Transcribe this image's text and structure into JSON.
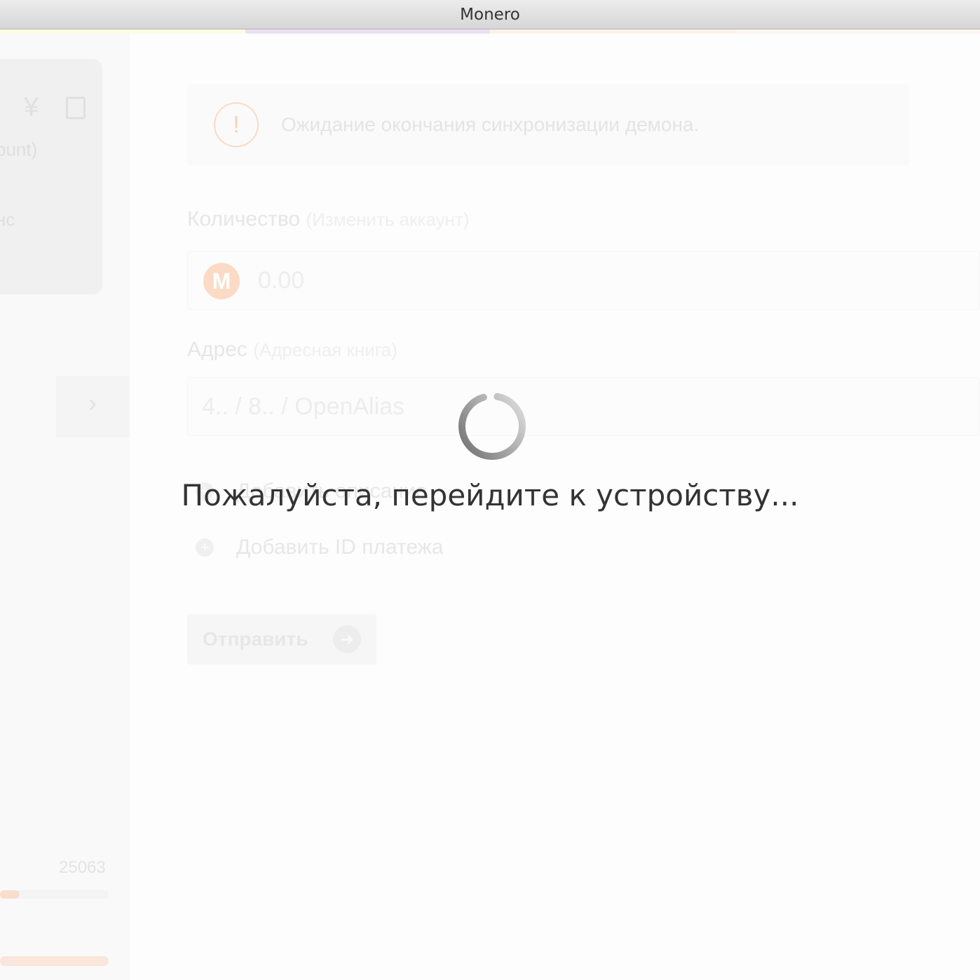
{
  "window": {
    "title": "Monero"
  },
  "colors": {
    "strip": [
      "#fffbe5",
      "#ece0f3",
      "#fff1e9",
      "#fff7f0"
    ],
    "accent": "#f26822"
  },
  "sidebar": {
    "currency_icon": "yen-icon",
    "currency_symbol": "¥",
    "export_icon": "export-icon",
    "account_fragment": "ount)",
    "balance_fragment": "нс",
    "nav_chevron": "›",
    "block_height": "25063",
    "sync_progress": 0.18,
    "memory_progress": 1.0
  },
  "main": {
    "warning": {
      "icon": "exclamation-icon",
      "symbol": "!",
      "text": "Ожидание окончания синхронизации демона."
    },
    "amount": {
      "label": "Количество",
      "open_paren": "(",
      "link": "Изменить аккаунт",
      "close_paren": ")",
      "logo": "monero-logo-icon",
      "logo_letter": "M",
      "placeholder": "0.00"
    },
    "address": {
      "label": "Адрес",
      "open_paren": "(",
      "link": "Адресная книга",
      "close_paren": ")",
      "placeholder": "4.. / 8.. / OpenAlias"
    },
    "add_description": "Добавить описание",
    "add_payment_id": "Добавить ID платежа",
    "send_label": "Отправить",
    "send_icon": "arrow-right-icon"
  },
  "overlay": {
    "spinner": "loading-spinner",
    "message": "Пожалуйста, перейдите к устройству..."
  }
}
